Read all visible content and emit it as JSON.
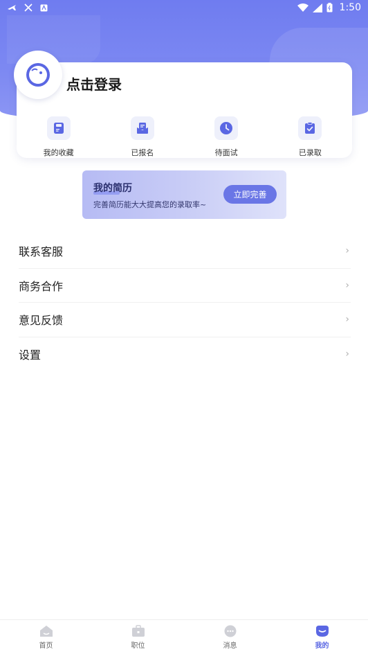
{
  "status_bar": {
    "time": "1:50"
  },
  "profile": {
    "login_text": "点击登录"
  },
  "quick_actions": [
    {
      "label": "我的收藏",
      "icon": "bookmark-icon"
    },
    {
      "label": "已报名",
      "icon": "envelope-icon"
    },
    {
      "label": "待面试",
      "icon": "clock-icon"
    },
    {
      "label": "已录取",
      "icon": "clipboard-check-icon"
    }
  ],
  "resume_banner": {
    "title": "我的简历",
    "subtitle": "完善简历能大大提高您的录取率~",
    "button_label": "立即完善"
  },
  "menu": [
    {
      "label": "联系客服"
    },
    {
      "label": "商务合作"
    },
    {
      "label": "意见反馈"
    },
    {
      "label": "设置"
    }
  ],
  "bottom_nav": [
    {
      "label": "首页",
      "icon": "home-icon"
    },
    {
      "label": "职位",
      "icon": "briefcase-icon"
    },
    {
      "label": "消息",
      "icon": "chat-icon"
    },
    {
      "label": "我的",
      "icon": "profile-icon",
      "active": true
    }
  ],
  "colors": {
    "accent": "#6f7cf0",
    "icon_inactive": "#cfd0d6",
    "active_nav": "#5a67e3"
  }
}
